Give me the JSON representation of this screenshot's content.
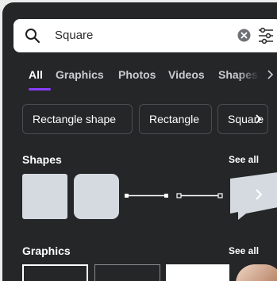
{
  "search": {
    "query": "Square",
    "clear_icon": "clear-icon",
    "filter_icon": "filter-sliders-icon"
  },
  "tabs": [
    {
      "label": "All",
      "active": true
    },
    {
      "label": "Graphics",
      "active": false
    },
    {
      "label": "Photos",
      "active": false
    },
    {
      "label": "Videos",
      "active": false
    },
    {
      "label": "Shapes",
      "active": false
    }
  ],
  "chips": [
    "Rectangle shape",
    "Rectangle",
    "Square"
  ],
  "sections": {
    "shapes": {
      "title": "Shapes",
      "see_all": "See all"
    },
    "graphics": {
      "title": "Graphics",
      "see_all": "See all"
    }
  },
  "colors": {
    "panel_bg": "#252627",
    "accent": "#8b3dff",
    "shape_fill": "#d4dae0"
  }
}
